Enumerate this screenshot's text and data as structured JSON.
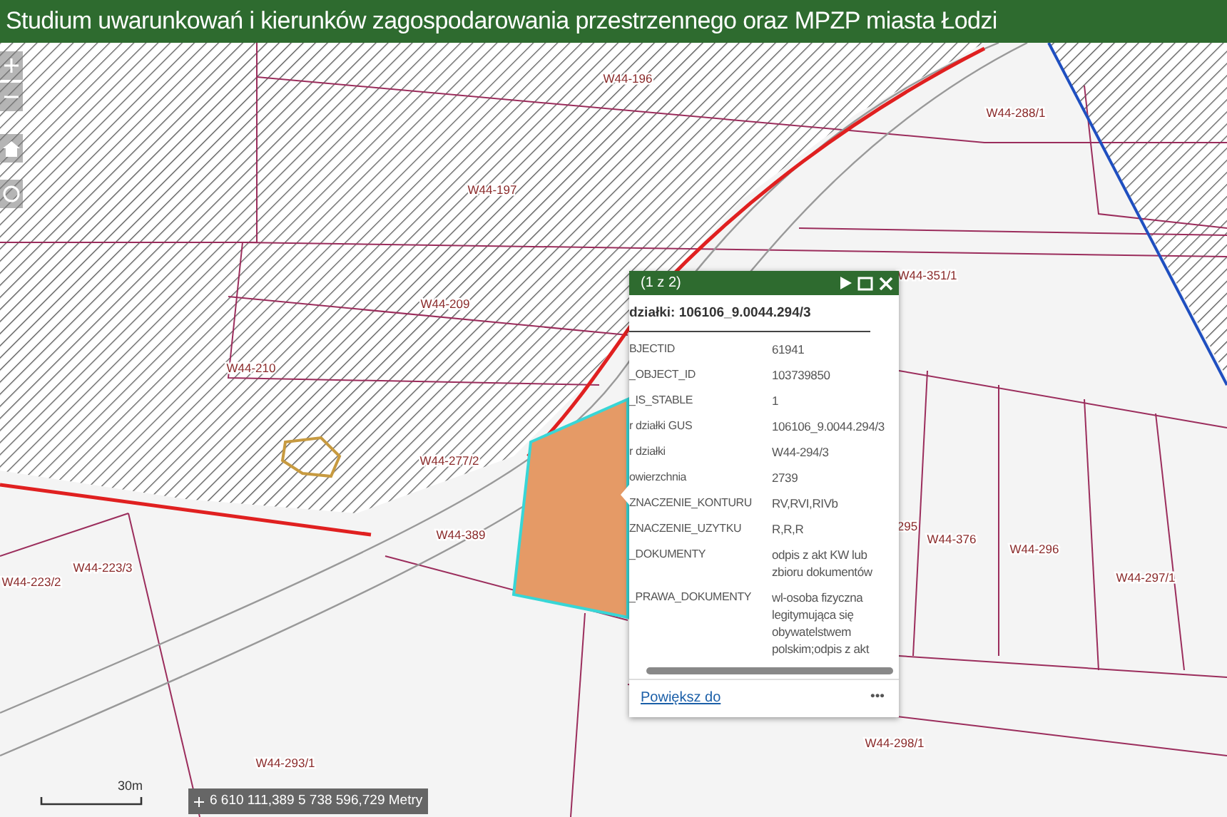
{
  "header": {
    "title": "Studium uwarunkowań i kierunków zagospodarowania przestrzennego oraz MPZP miasta Łodzi"
  },
  "map": {
    "labels": [
      "W44-196",
      "W44-288/1",
      "W44-197",
      "W44-351/1",
      "W44-209",
      "W44-210",
      "W44-277/2",
      "W44-389",
      "W44-223/3",
      "W44-223/2",
      "295",
      "W44-376",
      "W44-296",
      "W44-297/1",
      "W44-293/1",
      "W44-298/1"
    ]
  },
  "popup": {
    "counter": "(1 z 2)",
    "title": "działki: 106106_9.0044.294/3",
    "rows": [
      {
        "label": "BJECTID",
        "value": "61941"
      },
      {
        "label": "_OBJECT_ID",
        "value": "103739850"
      },
      {
        "label": "_IS_STABLE",
        "value": "1"
      },
      {
        "label": "r działki GUS",
        "value": "106106_9.0044.294/3"
      },
      {
        "label": "r działki",
        "value": "W44-294/3"
      },
      {
        "label": "owierzchnia",
        "value": "2739"
      },
      {
        "label": "ZNACZENIE_KONTURU",
        "value": "RV,RVI,RIVb"
      },
      {
        "label": "ZNACZENIE_UZYTKU",
        "value": "R,R,R"
      },
      {
        "label": "_DOKUMENTY",
        "value": "odpis z akt KW lub zbioru dokumentów"
      },
      {
        "label": "_PRAWA_DOKUMENTY",
        "value": "wl-osoba fizyczna legitymująca się obywatelstwem polskim;odpis z akt"
      }
    ],
    "zoom_link": "Powiększ do",
    "more": "•••"
  },
  "scale": {
    "label": "30m"
  },
  "coordinates": "6 610 111,389 5 738 596,729 Metry"
}
